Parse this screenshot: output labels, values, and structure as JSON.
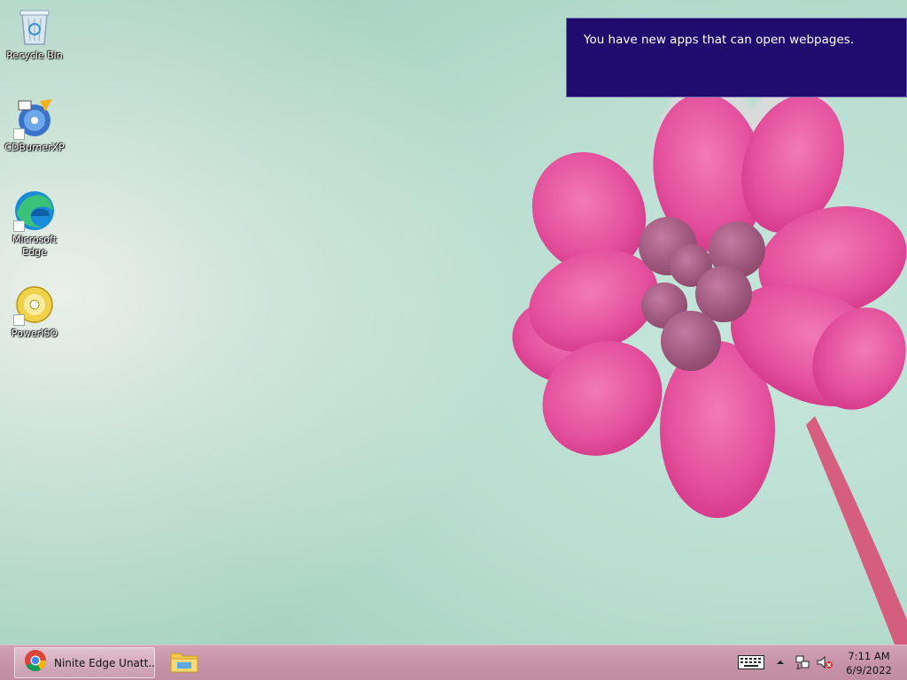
{
  "desktop": {
    "icons": [
      {
        "label": "Recycle Bin",
        "icon": "recycle-bin-icon"
      },
      {
        "label": "CDBurnerXP",
        "icon": "cdburnerxp-icon"
      },
      {
        "label": "Microsoft Edge",
        "icon": "edge-icon"
      },
      {
        "label": "PowerISO",
        "icon": "poweriso-icon"
      }
    ]
  },
  "toast": {
    "message": "You have new apps that can open webpages.",
    "background": "#1f0c6e"
  },
  "taskbar": {
    "tasks": [
      {
        "label": "Ninite Edge Unatt...",
        "icon": "chrome-icon",
        "active": true
      },
      {
        "label": "",
        "icon": "file-explorer-icon",
        "active": false
      }
    ],
    "tray": {
      "icons": [
        "keyboard-icon",
        "chevron-up-icon",
        "network-icon",
        "volume-muted-icon"
      ],
      "time": "7:11 AM",
      "date": "6/9/2022"
    },
    "color": "#c793a8"
  }
}
